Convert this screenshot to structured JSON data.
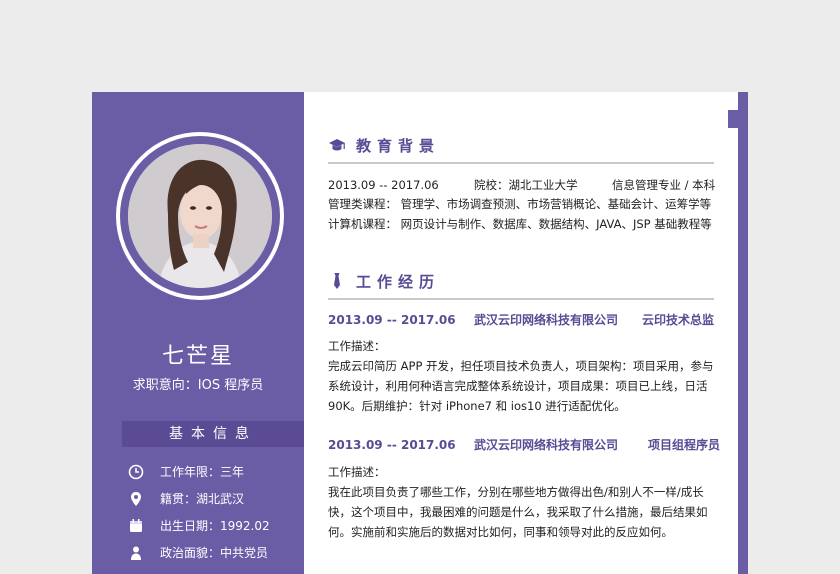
{
  "profile": {
    "name": "七芒星",
    "intent": "求职意向：IOS 程序员"
  },
  "basic_info": {
    "title": "基本信息",
    "items": [
      {
        "icon": "clock-icon",
        "text": "工作年限：三年"
      },
      {
        "icon": "location-icon",
        "text": "籍贯：湖北武汉"
      },
      {
        "icon": "calendar-icon",
        "text": "出生日期：1992.02"
      },
      {
        "icon": "person-icon",
        "text": "政治面貌：中共党员"
      }
    ]
  },
  "education": {
    "title": "教育背景",
    "icon": "graduation-cap-icon",
    "row1": {
      "period": "2013.09 -- 2017.06",
      "school": "院校：湖北工业大学",
      "major": "信息管理专业 / 本科"
    },
    "courses_mgmt": "管理类课程：    管理学、市场调查预测、市场营销概论、基础会计、运筹学等",
    "courses_cs": "计算机课程：    网页设计与制作、数据库、数据结构、JAVA、JSP 基础教程等"
  },
  "experience": {
    "title": "工作经历",
    "icon": "tie-icon",
    "jobs": [
      {
        "period": "2013.09 -- 2017.06",
        "company": "武汉云印网络科技有限公司",
        "role": "云印技术总监",
        "desc_label": "工作描述：",
        "lines": [
          "完成云印简历 APP 开发，担任项目技术负责人，项目架构：项目采用，参与",
          "系统设计，利用何种语言完成整体系统设计，项目成果：项目已上线，日活",
          "90K。后期维护：针对 iPhone7 和 ios10 进行适配优化。"
        ]
      },
      {
        "period": "2013.09 -- 2017.06",
        "company": "武汉云印网络科技有限公司",
        "role": "项目组程序员",
        "desc_label": "工作描述：",
        "lines": [
          "我在此项目负责了哪些工作，分别在哪些地方做得出色/和别人不一样/成长",
          "快，这个项目中，我最困难的问题是什么，我采取了什么措施，最后结果如",
          "何。实施前和实施后的数据对比如何，同事和领导对此的反应如何。"
        ]
      }
    ]
  },
  "colors": {
    "accent": "#6b5ca6",
    "accent_dark": "#5a4b94"
  }
}
